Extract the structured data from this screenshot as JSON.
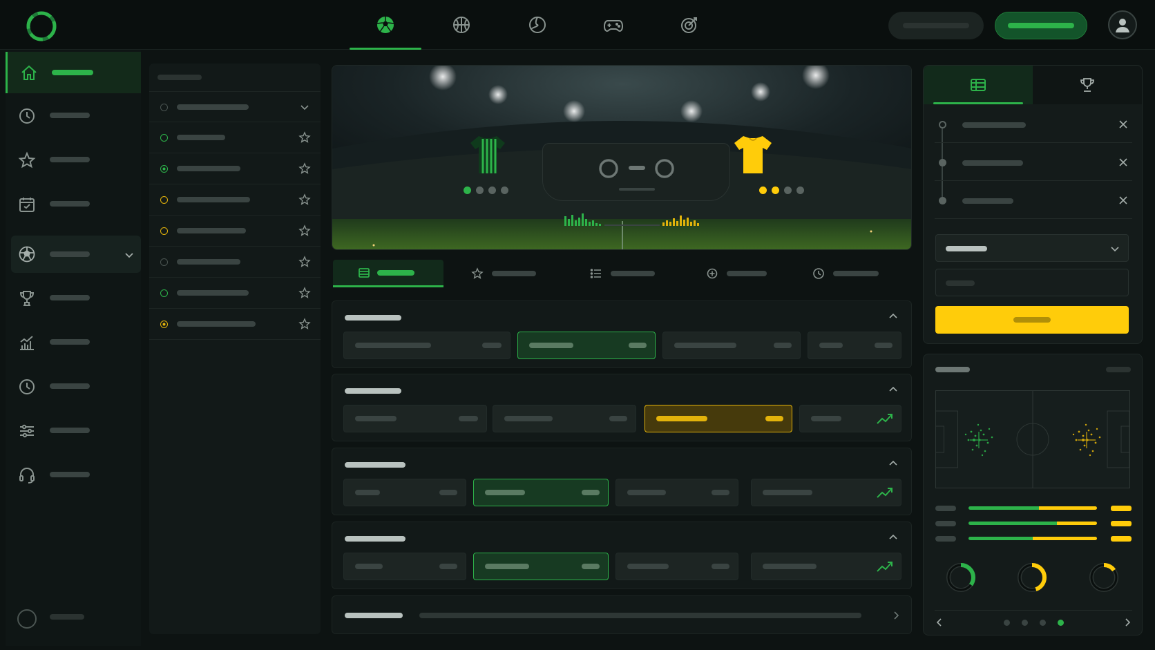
{
  "app": {
    "accent": "#2db34a",
    "highlight": "#ffcc0a",
    "background": "#0d1312"
  },
  "topbar": {
    "logo_icon": "ring-logo-icon",
    "sports_tabs": [
      {
        "icon": "soccer-ball-icon",
        "active": true
      },
      {
        "icon": "basketball-icon",
        "active": false
      },
      {
        "icon": "tennis-ball-icon",
        "active": false
      },
      {
        "icon": "gamepad-icon",
        "active": false
      },
      {
        "icon": "target-icon",
        "active": false
      }
    ],
    "login_button": {
      "label": ""
    },
    "signup_button": {
      "label": ""
    },
    "user_icon": "user-avatar-icon"
  },
  "sidebar": {
    "items": [
      {
        "icon": "home-icon",
        "label": "",
        "active": true
      },
      {
        "icon": "clock-icon",
        "label": ""
      },
      {
        "icon": "star-icon",
        "label": ""
      },
      {
        "icon": "calendar-icon",
        "label": ""
      },
      {
        "icon": "soccer-ball-icon",
        "label": "",
        "expanded": true
      },
      {
        "icon": "trophy-icon",
        "label": ""
      },
      {
        "icon": "bar-chart-icon",
        "label": ""
      },
      {
        "icon": "history-clock-icon",
        "label": ""
      },
      {
        "icon": "sliders-icon",
        "label": ""
      },
      {
        "icon": "headset-icon",
        "label": ""
      }
    ],
    "footer": {
      "icon": "status-circle-icon",
      "label": ""
    }
  },
  "leagues": {
    "header": "",
    "rows": [
      {
        "status": "grey",
        "action": "chevron-down-icon"
      },
      {
        "status": "green",
        "action": "star-icon"
      },
      {
        "status": "green",
        "action": "star-icon"
      },
      {
        "status": "yellow",
        "action": "star-icon"
      },
      {
        "status": "yellow",
        "action": "star-icon"
      },
      {
        "status": "grey",
        "action": "star-icon"
      },
      {
        "status": "green",
        "action": "star-icon"
      },
      {
        "status": "yellow",
        "action": "star-icon"
      }
    ]
  },
  "match": {
    "home_kit": "green-striped-jersey",
    "away_kit": "yellow-jersey",
    "home_form_dots": 4,
    "away_form_dots": 4,
    "score_display": "loading"
  },
  "market_tabs": [
    {
      "icon": "ticket-icon",
      "label": "",
      "active": true
    },
    {
      "icon": "star-icon",
      "label": ""
    },
    {
      "icon": "list-icon",
      "label": ""
    },
    {
      "icon": "plus-circle-icon",
      "label": ""
    },
    {
      "icon": "clock-icon",
      "label": ""
    }
  ],
  "markets": [
    {
      "title": "",
      "selected": 1,
      "selected_color": "green"
    },
    {
      "title": "",
      "selected": 2,
      "selected_color": "yellow"
    },
    {
      "title": "",
      "selected": 1,
      "selected_color": "green"
    },
    {
      "title": "",
      "selected": 1,
      "selected_color": "green"
    },
    {
      "title": ""
    }
  ],
  "betslip": {
    "tabs": [
      {
        "icon": "ticket-icon",
        "active": true
      },
      {
        "icon": "trophy-icon"
      }
    ],
    "selections": [
      {
        "label": ""
      },
      {
        "label": ""
      },
      {
        "label": ""
      }
    ],
    "stake_select": {
      "value": ""
    },
    "stake_input": {
      "placeholder": ""
    },
    "place_button": {
      "label": ""
    }
  },
  "stats": {
    "title": "",
    "bars": [
      {
        "home": 0.55,
        "away": 0.45
      },
      {
        "home": 0.69,
        "away": 0.31
      },
      {
        "home": 0.5,
        "away": 0.5
      }
    ],
    "rings": [
      {
        "color": "#2db34a",
        "value": 0.35
      },
      {
        "color": "#ffcc0a",
        "value": 0.45
      },
      {
        "color": "#ffcc0a",
        "value": 0.15
      }
    ],
    "pager": {
      "pages": 4,
      "active": 3
    }
  }
}
